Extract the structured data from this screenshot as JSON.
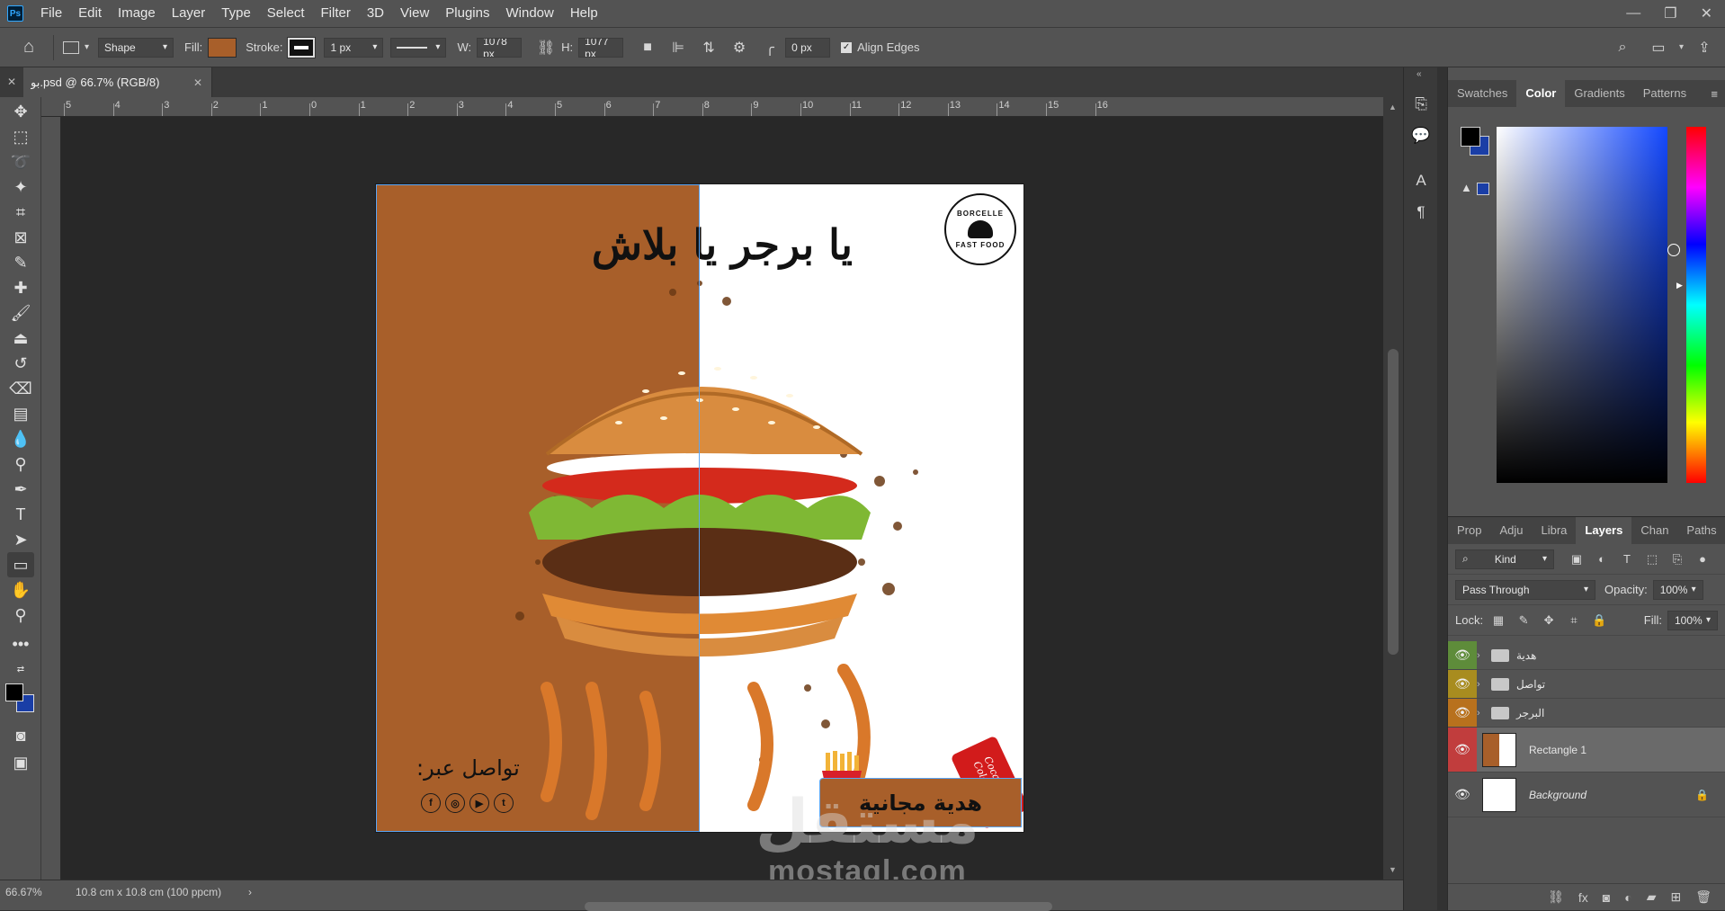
{
  "menubar": {
    "app_icon": "Ps",
    "items": [
      "File",
      "Edit",
      "Image",
      "Layer",
      "Type",
      "Select",
      "Filter",
      "3D",
      "View",
      "Plugins",
      "Window",
      "Help"
    ],
    "window_controls": [
      "minimize-icon",
      "restore-icon",
      "close-icon"
    ]
  },
  "options": {
    "mode": "Shape",
    "fill_label": "Fill:",
    "fill_color": "#a85f2a",
    "stroke_label": "Stroke:",
    "stroke_width": "1 px",
    "w_label": "W:",
    "w_value": "1078 px",
    "h_label": "H:",
    "h_value": "1077 px",
    "radius_value": "0 px",
    "align_edges_label": "Align Edges",
    "align_edges_checked": true
  },
  "document_tab": {
    "title": "بو.psd @ 66.7% (RGB/8)"
  },
  "ruler": {
    "labels": [
      "5",
      "4",
      "3",
      "2",
      "1",
      "0",
      "1",
      "2",
      "3",
      "4",
      "5",
      "6",
      "7",
      "8",
      "9",
      "10",
      "11",
      "12",
      "13",
      "14",
      "15",
      "16"
    ]
  },
  "design": {
    "headline": "يا برجر يا بلاش",
    "logo_top": "BORCELLE",
    "logo_bottom": "FAST FOOD",
    "contact_label": "تواصل عبر:",
    "socials": [
      "f",
      "◎",
      "▶",
      "t"
    ],
    "gift_text": "هدية مجانية",
    "can_logo": "Coca-Cola",
    "brown": "#a85f2a"
  },
  "watermark": {
    "arabic": "مستقل",
    "latin": "mostaql.com"
  },
  "status": {
    "zoom": "66.67%",
    "doc_size": "10.8 cm x 10.8 cm (100 ppcm)"
  },
  "color_panel": {
    "tabs": [
      "Swatches",
      "Color",
      "Gradients",
      "Patterns"
    ],
    "active_tab": "Color",
    "foreground": "#000000",
    "background": "#1a3ea6"
  },
  "layers_panel": {
    "tabs": [
      "Prop",
      "Adju",
      "Libra",
      "Layers",
      "Chan",
      "Paths"
    ],
    "active_tab": "Layers",
    "filter_kind": "Kind",
    "blend_mode": "Pass Through",
    "opacity_label": "Opacity:",
    "opacity_value": "100%",
    "lock_label": "Lock:",
    "fill_label": "Fill:",
    "fill_value": "100%",
    "layers": [
      {
        "name": "هدية",
        "type": "group",
        "eye_color": "#5e8c3a"
      },
      {
        "name": "تواصل",
        "type": "group",
        "eye_color": "#a88c1f"
      },
      {
        "name": "البرجر",
        "type": "group",
        "eye_color": "#b8711d"
      },
      {
        "name": "Rectangle 1",
        "type": "shape",
        "eye_color": "#c13d3d",
        "selected": true
      },
      {
        "name": "Background",
        "type": "background",
        "eye_color": "",
        "locked": true
      }
    ]
  }
}
